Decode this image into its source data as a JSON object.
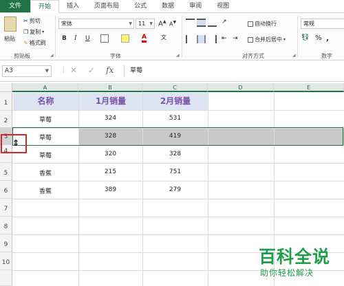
{
  "tabs": [
    "文件",
    "开始",
    "插入",
    "页面布局",
    "公式",
    "数据",
    "审阅",
    "视图"
  ],
  "ribbon": {
    "clipboard": {
      "paste": "粘贴",
      "cut": "剪切",
      "copy": "复制",
      "copy_arrow": "▾",
      "format_painter": "格式刷",
      "label": "剪贴板"
    },
    "font": {
      "name": "宋体",
      "size": "11",
      "bold": "B",
      "italic": "I",
      "underline": "U",
      "grow": "A",
      "shrink": "A",
      "label": "字体",
      "color_glyph": "A"
    },
    "alignment": {
      "wrap": "自动换行",
      "merge": "合并后居中",
      "label": "对齐方式"
    },
    "number": {
      "format": "常规",
      "percent": "%",
      "comma": ",",
      "label": "数字"
    }
  },
  "formula_bar": {
    "name_box": "A3",
    "content": "草莓"
  },
  "columns": [
    "A",
    "B",
    "C",
    "D",
    "E"
  ],
  "rows": [
    "1",
    "2",
    "3",
    "4",
    "5",
    "6",
    "7",
    "8",
    "9",
    "10"
  ],
  "table": {
    "headers": [
      "名称",
      "1月销量",
      "2月销量"
    ],
    "rows": [
      [
        "草莓",
        "324",
        "531"
      ],
      [
        "草莓",
        "328",
        "419"
      ],
      [
        "草莓",
        "320",
        "328"
      ],
      [
        "香蕉",
        "215",
        "751"
      ],
      [
        "香蕉",
        "389",
        "279"
      ]
    ]
  },
  "watermark": {
    "title": "百科全说",
    "subtitle": "助你轻松解决"
  },
  "colors": {
    "accent": "#217346",
    "header_fill": "#dde4f2",
    "header_text": "#7b52a8",
    "highlight": "#d9232a",
    "watermark": "#1f9e4b"
  }
}
